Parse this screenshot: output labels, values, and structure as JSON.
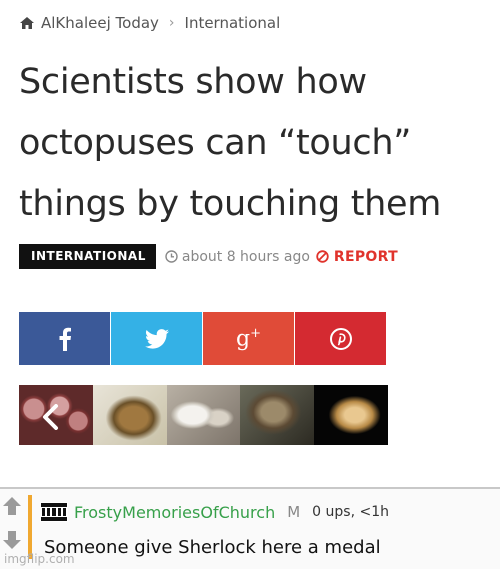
{
  "breadcrumb": {
    "site": "AlKhaleej Today",
    "section": "International"
  },
  "article": {
    "title_lines": [
      "Scientists show how",
      "octopuses can “touch”",
      "things by touching them"
    ],
    "tag": "INTERNATIONAL",
    "time": "about 8 hours ago",
    "report": "REPORT"
  },
  "share": {
    "icons": [
      "facebook-icon",
      "twitter-icon",
      "google-plus-icon",
      "pinterest-icon"
    ],
    "colors": {
      "facebook": "#3b5998",
      "twitter": "#34b1e6",
      "google_plus": "#e04b38",
      "pinterest": "#d42a31"
    },
    "gplus_label": "g+"
  },
  "comment": {
    "username": "FrostyMemoriesOfChurch",
    "mod_mark": "M",
    "ups": "0 ups, <1h",
    "text": "Someone give Sherlock here a medal",
    "username_color": "#37a04a",
    "accent_color": "#f0a830"
  },
  "watermark": "imgflip.com"
}
